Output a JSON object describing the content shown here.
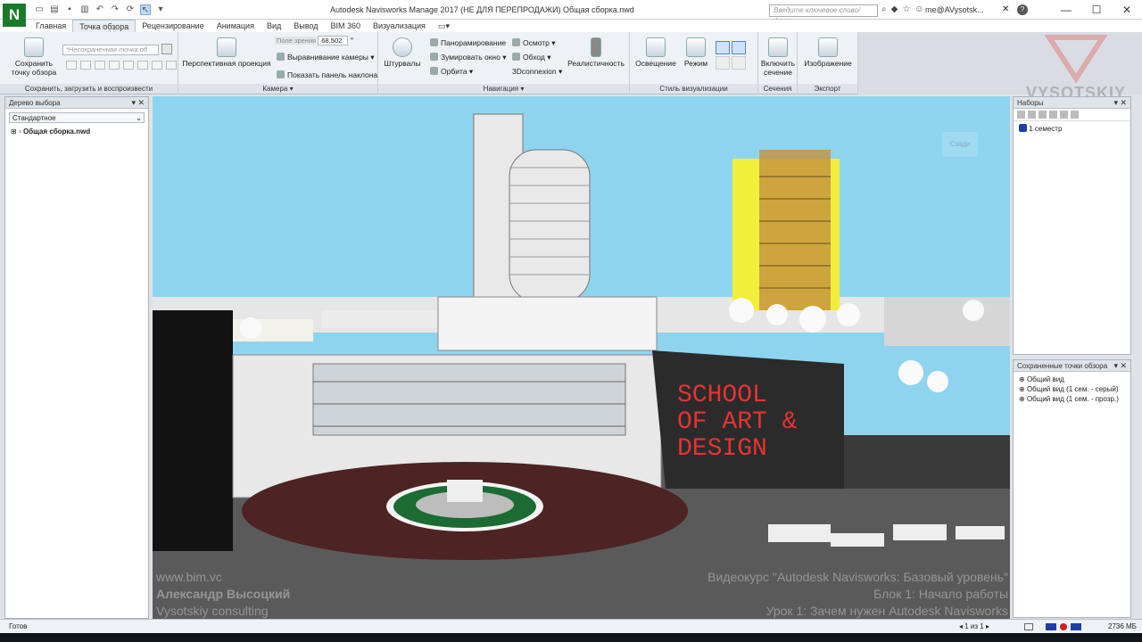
{
  "app": {
    "logo": "N",
    "title": "Autodesk Navisworks Manage 2017 (НЕ ДЛЯ ПЕРЕПРОДАЖИ)    Общая сборка.nwd",
    "search_placeholder": "Введите ключевое слово/фразу",
    "user": "me@AVysotsk...",
    "help": "?"
  },
  "tabs": [
    "Главная",
    "Точка обзора",
    "Рецензирование",
    "Анимация",
    "Вид",
    "Вывод",
    "BIM 360",
    "Визуализация"
  ],
  "ribbon": {
    "save_viewpoint": "Сохранить точку обзора",
    "viewpoint_select": "*Несохраненная точка об",
    "group1_label": "Сохранить, загрузить и воспроизвести",
    "perspective": "Перспективная проекция",
    "fov_label": "Поле зрения",
    "fov_value": "68,502",
    "fov_unit": "°",
    "align_camera": "Выравнивание камеры",
    "show_tilt": "Показать панель наклона",
    "camera_label": "Камера",
    "steering": "Штурвалы",
    "pan": "Панорамирование",
    "zoom_window": "Зумировать окно",
    "orbit": "Орбита",
    "look": "Осмотр",
    "walk": "Обход",
    "connexion": "3Dconnexion",
    "realism": "Реалистичность",
    "navigation_label": "Навигация",
    "lighting": "Освещение",
    "mode": "Режим",
    "visual_style_label": "Стиль визуализации",
    "enable_section": "Включить сечение",
    "sections_label": "Сечения",
    "image": "Изображение",
    "export_label": "Экспорт"
  },
  "selection_tree": {
    "title": "Дерево выбора",
    "dropdown": "Стандартное",
    "root": "Общая сборка.nwd"
  },
  "sets": {
    "title": "Наборы",
    "items": [
      "1 семестр"
    ]
  },
  "saved_viewpoints": {
    "title": "Сохраненные точки обзора",
    "items": [
      "Общий вид",
      "Общий вид (1 сем. - серый)",
      "Общий вид (1 сем. - прозр.)"
    ]
  },
  "viewport": {
    "sign": [
      "SCHOOL",
      "OF ART &",
      "DESIGN"
    ],
    "viewcube": "Сзади",
    "watermark_left": [
      "www.bim.vc",
      "Александр Высоцкий",
      "Vysotskiy consulting"
    ],
    "watermark_right": [
      "Видеокурс \"Autodesk Navisworks: Базовый уровень\"",
      "Блок 1: Начало работы",
      "Урок 1: Зачем нужен Autodesk Navisworks"
    ],
    "brand": "VYSOTSKIY"
  },
  "status": {
    "left": "Готов",
    "page": "1 из 1",
    "memory": "2736 МБ"
  },
  "colors": {
    "sky": "#8fd4ee",
    "sign_text": "#e53333",
    "tower_yellow": "#f2ee3c",
    "ground": "#5a5a5a",
    "plaza": "#4d2323"
  }
}
